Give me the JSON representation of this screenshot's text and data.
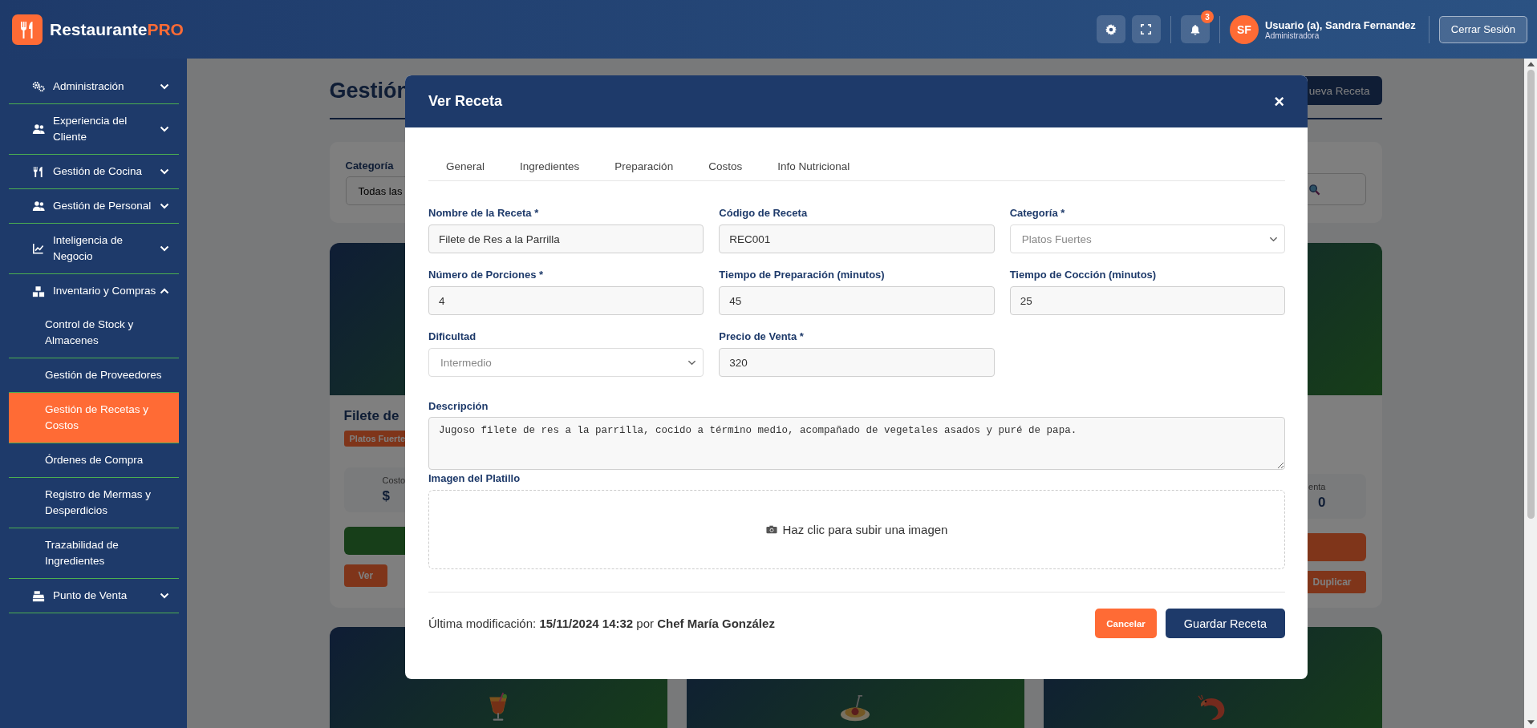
{
  "header": {
    "brand": "Restaurante",
    "brand_accent": "PRO",
    "notification_count": "3",
    "avatar_initials": "SF",
    "user_name": "Usuario (a), Sandra Fernandez",
    "user_role": "Administradora",
    "logout_button": "Cerrar Sesión"
  },
  "sidebar": {
    "items": [
      {
        "label": "Administración",
        "expanded": false
      },
      {
        "label": "Experiencia del Cliente",
        "expanded": false
      },
      {
        "label": "Gestión de Cocina",
        "expanded": false
      },
      {
        "label": "Gestión de Personal",
        "expanded": false
      },
      {
        "label": "Inteligencia de Negocio",
        "expanded": false
      },
      {
        "label": "Inventario y Compras",
        "expanded": true,
        "children": [
          {
            "label": "Control de Stock y Almacenes",
            "selected": false
          },
          {
            "label": "Gestión de Proveedores",
            "selected": false
          },
          {
            "label": "Gestión de Recetas y Costos",
            "selected": true
          },
          {
            "label": "Órdenes de Compra",
            "selected": false
          },
          {
            "label": "Registro de Mermas y Desperdicios",
            "selected": false
          },
          {
            "label": "Trazabilidad de Ingredientes",
            "selected": false
          }
        ]
      },
      {
        "label": "Punto de Venta",
        "expanded": false
      }
    ]
  },
  "page": {
    "title": "Gestión",
    "new_button": "ueva Receta",
    "filter": {
      "label": "Categoría",
      "value": "Todas las"
    },
    "card_left": {
      "title": "Filete de",
      "tag": "Platos Fuerte",
      "stat_label": "Costo",
      "stat_value": "$",
      "action_button": "Ver"
    },
    "card_right": {
      "stat_label": "enta",
      "stat_value": "0",
      "action_button": "Duplicar"
    }
  },
  "modal": {
    "title": "Ver Receta",
    "close": "×",
    "tabs": [
      "General",
      "Ingredientes",
      "Preparación",
      "Costos",
      "Info Nutricional"
    ],
    "fields": [
      {
        "label": "Nombre de la Receta *",
        "kind": "input",
        "value": "Filete de Res a la Parrilla"
      },
      {
        "label": "Código de Receta",
        "kind": "input",
        "value": "REC001"
      },
      {
        "label": "Categoría *",
        "kind": "select",
        "value": "Platos Fuertes"
      },
      {
        "label": "Número de Porciones *",
        "kind": "input",
        "value": "4"
      },
      {
        "label": "Tiempo de Preparación (minutos)",
        "kind": "input",
        "value": "45"
      },
      {
        "label": "Tiempo de Cocción (minutos)",
        "kind": "input",
        "value": "25"
      },
      {
        "label": "Dificultad",
        "kind": "select",
        "value": "Intermedio"
      },
      {
        "label": "Precio de Venta *",
        "kind": "input",
        "value": "320"
      }
    ],
    "description": {
      "label": "Descripción",
      "value": "Jugoso filete de res a la parrilla, cocido a término medio, acompañado de vegetales asados y puré de papa."
    },
    "image": {
      "label": "Imagen del Platillo",
      "prompt": "Haz clic para subir una imagen"
    },
    "footer": {
      "note": "Última modificación: **15/11/2024 14:32** por **Chef María González**",
      "cancel_button": "Cancelar",
      "save_button": "Guardar Receta"
    }
  }
}
